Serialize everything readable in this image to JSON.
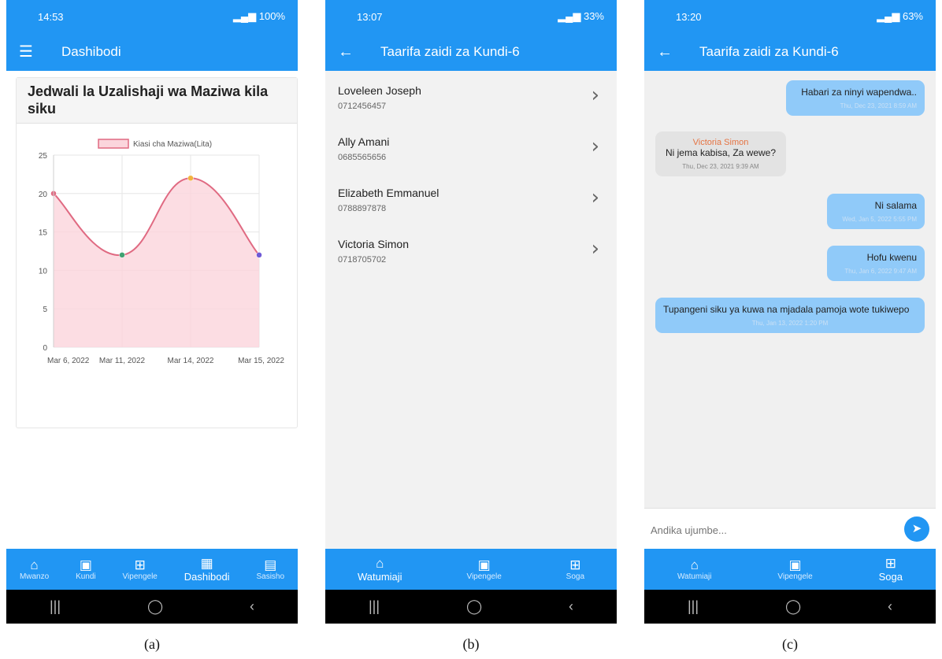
{
  "captions": [
    "(a)",
    "(b)",
    "(c)"
  ],
  "colors": {
    "primary": "#2196f3",
    "chart_fill": "#fbd5dc",
    "chart_line": "#e06a82",
    "my_bubble": "#90caf9",
    "other_bubble": "#e3e3e3",
    "sender_name": "#e57342"
  },
  "screenA": {
    "status": {
      "time": "14:53",
      "battery": "100%"
    },
    "appbar": {
      "title": "Dashibodi",
      "menu_icon": "menu-icon"
    },
    "card_title": "Jedwali la Uzalishaji wa Maziwa kila siku",
    "nav": [
      {
        "label": "Mwanzo",
        "icon": "home-icon",
        "active": false
      },
      {
        "label": "Kundi",
        "icon": "person-box-icon",
        "active": false
      },
      {
        "label": "Vipengele",
        "icon": "grid-icon",
        "active": false
      },
      {
        "label": "Dashibodi",
        "icon": "dashboard-icon",
        "active": true
      },
      {
        "label": "Sasisho",
        "icon": "update-icon",
        "active": false
      }
    ]
  },
  "chart_data": {
    "type": "area",
    "title": "",
    "legend": [
      "Kiasi cha Maziwa(Lita)"
    ],
    "legend_position": "top",
    "categories": [
      "Mar 6, 2022",
      "Mar 11, 2022",
      "Mar 14, 2022",
      "Mar 15, 2022"
    ],
    "series": [
      {
        "name": "Kiasi cha Maziwa(Lita)",
        "values": [
          20,
          12,
          22,
          12
        ]
      }
    ],
    "point_colors": [
      "#e06a82",
      "#3fa272",
      "#f3b33d",
      "#6f5ad6"
    ],
    "yticks": [
      0,
      5,
      10,
      15,
      20,
      25
    ],
    "ylim": [
      0,
      25
    ],
    "grid": true,
    "xlabel": "",
    "ylabel": ""
  },
  "screenB": {
    "status": {
      "time": "13:07",
      "battery": "33%"
    },
    "appbar": {
      "title": "Taarifa zaidi za Kundi-6"
    },
    "members": [
      {
        "name": "Loveleen Joseph",
        "phone": "0712456457"
      },
      {
        "name": "Ally Amani",
        "phone": "0685565656"
      },
      {
        "name": "Elizabeth Emmanuel",
        "phone": "0788897878"
      },
      {
        "name": "Victoria Simon",
        "phone": "0718705702"
      }
    ],
    "nav": [
      {
        "label": "Watumiaji",
        "icon": "home-icon",
        "active": true
      },
      {
        "label": "Vipengele",
        "icon": "person-box-icon",
        "active": false
      },
      {
        "label": "Soga",
        "icon": "grid-icon",
        "active": false
      }
    ]
  },
  "screenC": {
    "status": {
      "time": "13:20",
      "battery": "63%"
    },
    "appbar": {
      "title": "Taarifa zaidi za Kundi-6"
    },
    "messages": [
      {
        "mine": true,
        "sender": "",
        "text": "Habari za ninyi wapendwa..",
        "time": "Thu, Dec 23, 2021 8:59 AM"
      },
      {
        "mine": false,
        "sender": "Victoria Simon",
        "text": "Ni jema kabisa, Za wewe?",
        "time": "Thu, Dec 23, 2021 9:39 AM"
      },
      {
        "mine": true,
        "sender": "",
        "text": "Ni salama",
        "time": "Wed, Jan 5, 2022 5:55 PM"
      },
      {
        "mine": true,
        "sender": "",
        "text": "Hofu kwenu",
        "time": "Thu, Jan 6, 2022 9:47 AM"
      },
      {
        "mine": true,
        "sender": "",
        "text": "Tupangeni siku ya kuwa na mjadala pamoja wote tukiwepo",
        "time": "Thu, Jan 13, 2022 1:20 PM"
      }
    ],
    "input_placeholder": "Andika ujumbe...",
    "nav": [
      {
        "label": "Watumiaji",
        "icon": "home-icon",
        "active": false
      },
      {
        "label": "Vipengele",
        "icon": "person-box-icon",
        "active": false
      },
      {
        "label": "Soga",
        "icon": "grid-icon",
        "active": true
      }
    ]
  }
}
